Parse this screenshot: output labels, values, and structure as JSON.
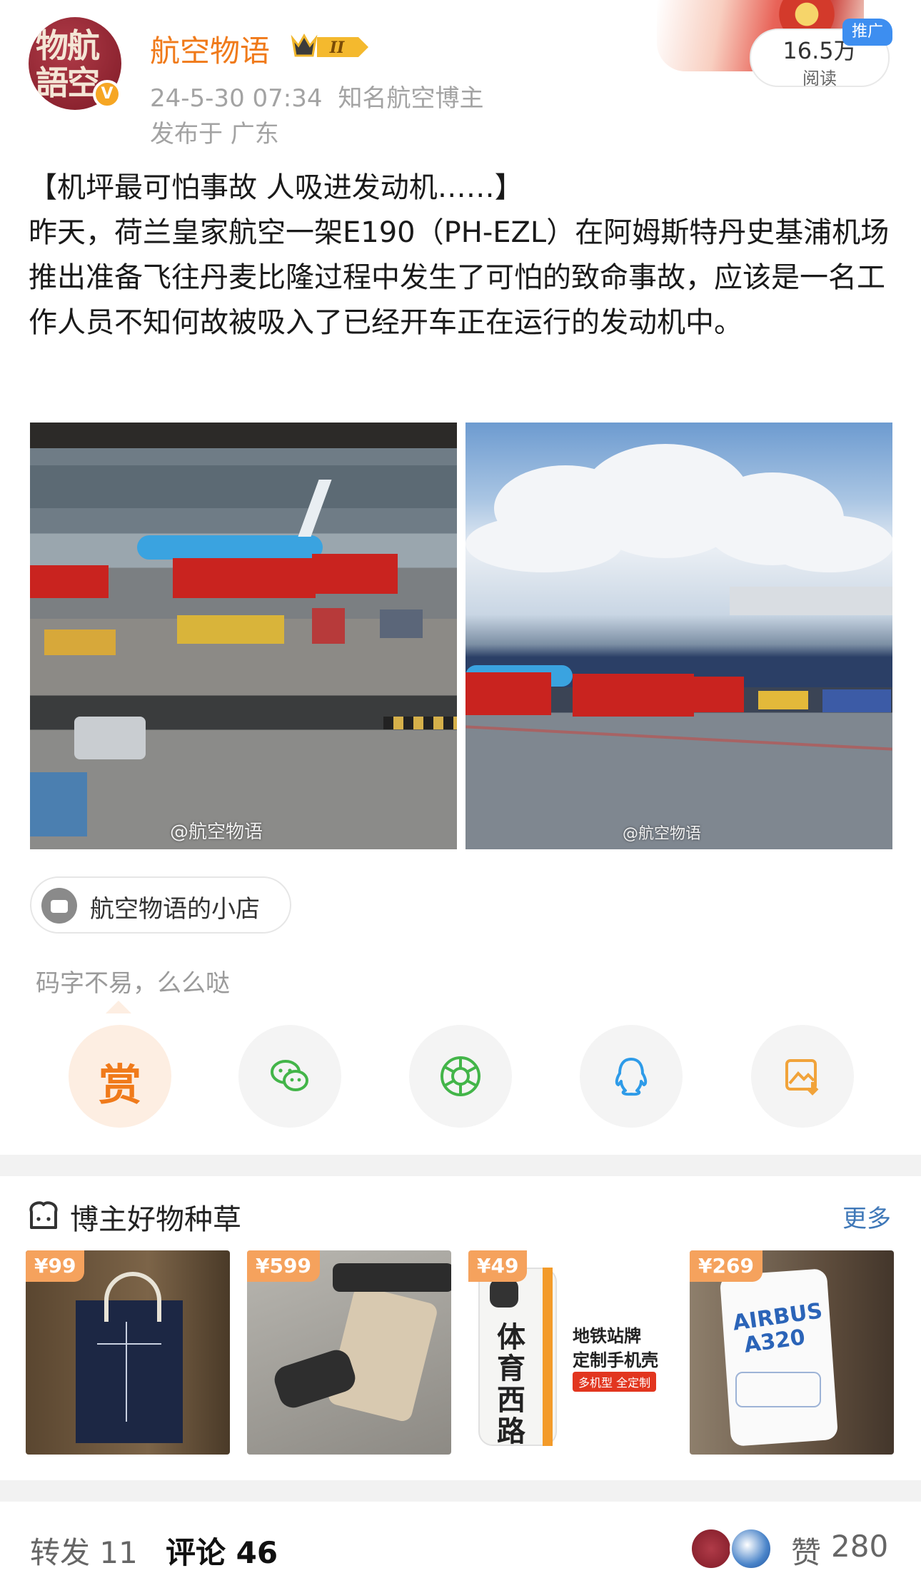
{
  "author": {
    "avatar_text": "物航語空",
    "name": "航空物语",
    "level": "II",
    "verified_mark": "V",
    "timestamp": "24-5-30 07:34",
    "title": "知名航空博主",
    "location": "发布于 广东"
  },
  "promo": {
    "read_count": "16.5万",
    "read_label": "阅读",
    "tag": "推广"
  },
  "post": {
    "headline": "【机坪最可怕事故 人吸进发动机……】",
    "body": "昨天，荷兰皇家航空一架E190（PH-EZL）在阿姆斯特丹史基浦机场推出准备飞往丹麦比隆过程中发生了可怕的致命事故，应该是一名工作人员不知何故被吸入了已经开车正在运行的发动机中。"
  },
  "photos": [
    {
      "watermark": "@航空物语"
    },
    {
      "watermark": "@航空物语"
    }
  ],
  "shop": {
    "label": "航空物语的小店"
  },
  "reward_tip": "码字不易，么么哒",
  "share": {
    "reward_char": "赏",
    "icons": [
      "reward-icon",
      "wechat-icon",
      "moments-icon",
      "qq-icon",
      "save-image-icon"
    ]
  },
  "goods": {
    "title": "博主好物种草",
    "more": "更多",
    "items": [
      {
        "price": "¥99"
      },
      {
        "price": "¥599"
      },
      {
        "price": "¥49",
        "line1": "地铁站牌",
        "line2": "定制手机壳",
        "tag": "多机型 全定制",
        "station": "体育西路"
      },
      {
        "price": "¥269",
        "brand": "AIRBUS",
        "model": "A320"
      }
    ]
  },
  "footer": {
    "repost": "转发 11",
    "comment": "评论 46",
    "like_icon": "赞",
    "like_count": "280"
  },
  "colors": {
    "accent": "#f07a1a",
    "link": "#3f78b8",
    "price": "#f5a25d"
  }
}
